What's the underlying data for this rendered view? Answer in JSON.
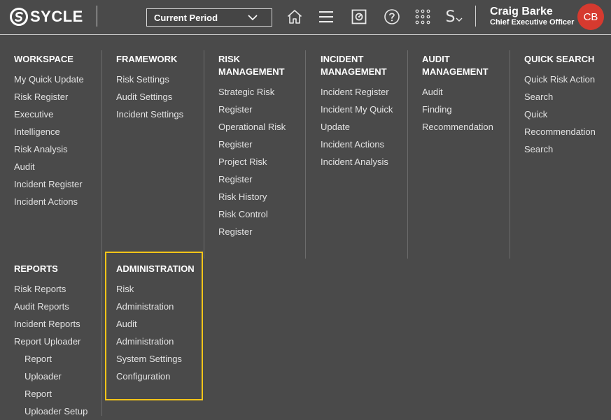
{
  "header": {
    "logo_text": "SYCLE",
    "period_select": {
      "value": "Current Period"
    },
    "icons": [
      "home-icon",
      "hamburger-menu-icon",
      "dashboard-icon",
      "help-icon",
      "apps-grid-icon",
      "s-dropdown-icon"
    ],
    "s_icon_glyph": "S",
    "user": {
      "name": "Craig Barke",
      "role": "Chief Executive Officer",
      "initials": "CB"
    }
  },
  "colors": {
    "background": "#4a4a4a",
    "avatar": "#d63a2f",
    "highlight": "#f5c518"
  },
  "menu": {
    "workspace": {
      "title": "WORKSPACE",
      "items": [
        "My Quick Update",
        "Risk Register",
        "Executive",
        "Intelligence",
        "Risk Analysis",
        "Audit",
        "Incident Register",
        "Incident Actions"
      ]
    },
    "framework": {
      "title": "FRAMEWORK",
      "items": [
        "Risk Settings",
        "Audit Settings",
        "Incident Settings"
      ]
    },
    "risk_management": {
      "title_line1": "RISK",
      "title_line2": "MANAGEMENT",
      "items": [
        "Strategic Risk",
        "Register",
        "Operational Risk",
        "Register",
        "Project Risk",
        "Register",
        "Risk History",
        "Risk Control",
        "Register"
      ]
    },
    "incident_management": {
      "title_line1": "INCIDENT",
      "title_line2": "MANAGEMENT",
      "items": [
        "Incident Register",
        "Incident My Quick",
        "Update",
        "Incident Actions",
        "Incident Analysis"
      ]
    },
    "audit_management": {
      "title_line1": "AUDIT",
      "title_line2": "MANAGEMENT",
      "items": [
        "Audit",
        "Finding",
        "Recommendation"
      ]
    },
    "quick_search": {
      "title": "QUICK SEARCH",
      "items": [
        "Quick Risk Action",
        "Search",
        "Quick",
        "Recommendation",
        "Search"
      ]
    },
    "reports": {
      "title": "REPORTS",
      "items": [
        "Risk Reports",
        "Audit Reports",
        "Incident Reports",
        "Report Uploader"
      ],
      "sub_items": [
        "Report",
        "Uploader",
        "Report",
        "Uploader Setup"
      ]
    },
    "administration": {
      "title": "ADMINISTRATION",
      "items": [
        "Risk",
        "Administration",
        "Audit",
        "Administration",
        "System Settings",
        "Configuration"
      ]
    }
  }
}
